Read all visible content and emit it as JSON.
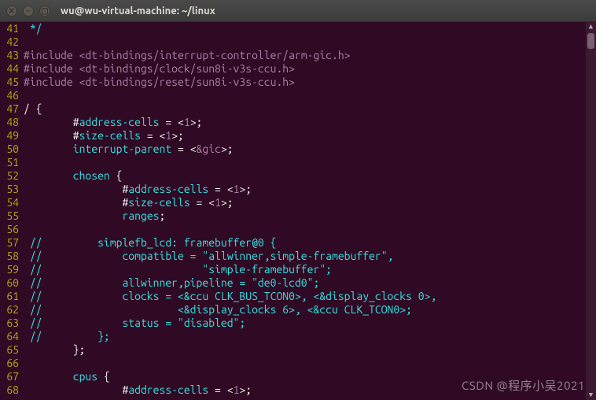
{
  "window": {
    "title": "wu@wu-virtual-machine: ~/linux"
  },
  "watermark": "CSDN @程序小吴2021",
  "gutter_start": 41,
  "lines": [
    [
      [
        "c-comment",
        " */"
      ]
    ],
    [],
    [
      [
        "c-keyword",
        "#include "
      ],
      [
        "c-string",
        "<dt-bindings/interrupt-controller/arm-gic.h>"
      ]
    ],
    [
      [
        "c-keyword",
        "#include "
      ],
      [
        "c-string",
        "<dt-bindings/clock/sun8i-v3s-ccu.h>"
      ]
    ],
    [
      [
        "c-keyword",
        "#include "
      ],
      [
        "c-string",
        "<dt-bindings/reset/sun8i-v3s-ccu.h>"
      ]
    ],
    [],
    [
      [
        "c-plain",
        "/ {"
      ]
    ],
    [
      [
        "c-plain",
        "        #"
      ],
      [
        "c-ident",
        "address-cells"
      ],
      [
        "c-plain",
        " = <"
      ],
      [
        "c-number",
        "1"
      ],
      [
        "c-plain",
        ">;"
      ]
    ],
    [
      [
        "c-plain",
        "        #"
      ],
      [
        "c-ident",
        "size-cells"
      ],
      [
        "c-plain",
        " = <"
      ],
      [
        "c-number",
        "1"
      ],
      [
        "c-plain",
        ">;"
      ]
    ],
    [
      [
        "c-plain",
        "        "
      ],
      [
        "c-ident",
        "interrupt-parent"
      ],
      [
        "c-plain",
        " = <"
      ],
      [
        "c-number",
        "&gic"
      ],
      [
        "c-plain",
        ">;"
      ]
    ],
    [],
    [
      [
        "c-plain",
        "        "
      ],
      [
        "c-ident",
        "chosen"
      ],
      [
        "c-plain",
        " {"
      ]
    ],
    [
      [
        "c-plain",
        "                #"
      ],
      [
        "c-ident",
        "address-cells"
      ],
      [
        "c-plain",
        " = <"
      ],
      [
        "c-number",
        "1"
      ],
      [
        "c-plain",
        ">;"
      ]
    ],
    [
      [
        "c-plain",
        "                #"
      ],
      [
        "c-ident",
        "size-cells"
      ],
      [
        "c-plain",
        " = <"
      ],
      [
        "c-number",
        "1"
      ],
      [
        "c-plain",
        ">;"
      ]
    ],
    [
      [
        "c-plain",
        "                "
      ],
      [
        "c-ident",
        "ranges"
      ],
      [
        "c-plain",
        ";"
      ]
    ],
    [],
    [
      [
        "c-comment",
        " //         simplefb_lcd: framebuffer@0 {"
      ]
    ],
    [
      [
        "c-comment",
        " //             compatible = \"allwinner,simple-framebuffer\","
      ]
    ],
    [
      [
        "c-comment",
        " //                          \"simple-framebuffer\";"
      ]
    ],
    [
      [
        "c-comment",
        " //             allwinner,pipeline = \"de0-lcd0\";"
      ]
    ],
    [
      [
        "c-comment",
        " //             clocks = <&ccu CLK_BUS_TCON0>, <&display_clocks 0>,"
      ]
    ],
    [
      [
        "c-comment",
        " //                      <&display_clocks 6>, <&ccu CLK_TCON0>;"
      ]
    ],
    [
      [
        "c-comment",
        " //             status = \"disabled\";"
      ]
    ],
    [
      [
        "c-comment",
        " //         };"
      ]
    ],
    [
      [
        "c-plain",
        "        };"
      ]
    ],
    [],
    [
      [
        "c-plain",
        "        "
      ],
      [
        "c-ident",
        "cpus"
      ],
      [
        "c-plain",
        " {"
      ]
    ],
    [
      [
        "c-plain",
        "                #"
      ],
      [
        "c-ident",
        "address-cells"
      ],
      [
        "c-plain",
        " = <"
      ],
      [
        "c-number",
        "1"
      ],
      [
        "c-plain",
        ">;"
      ]
    ]
  ]
}
